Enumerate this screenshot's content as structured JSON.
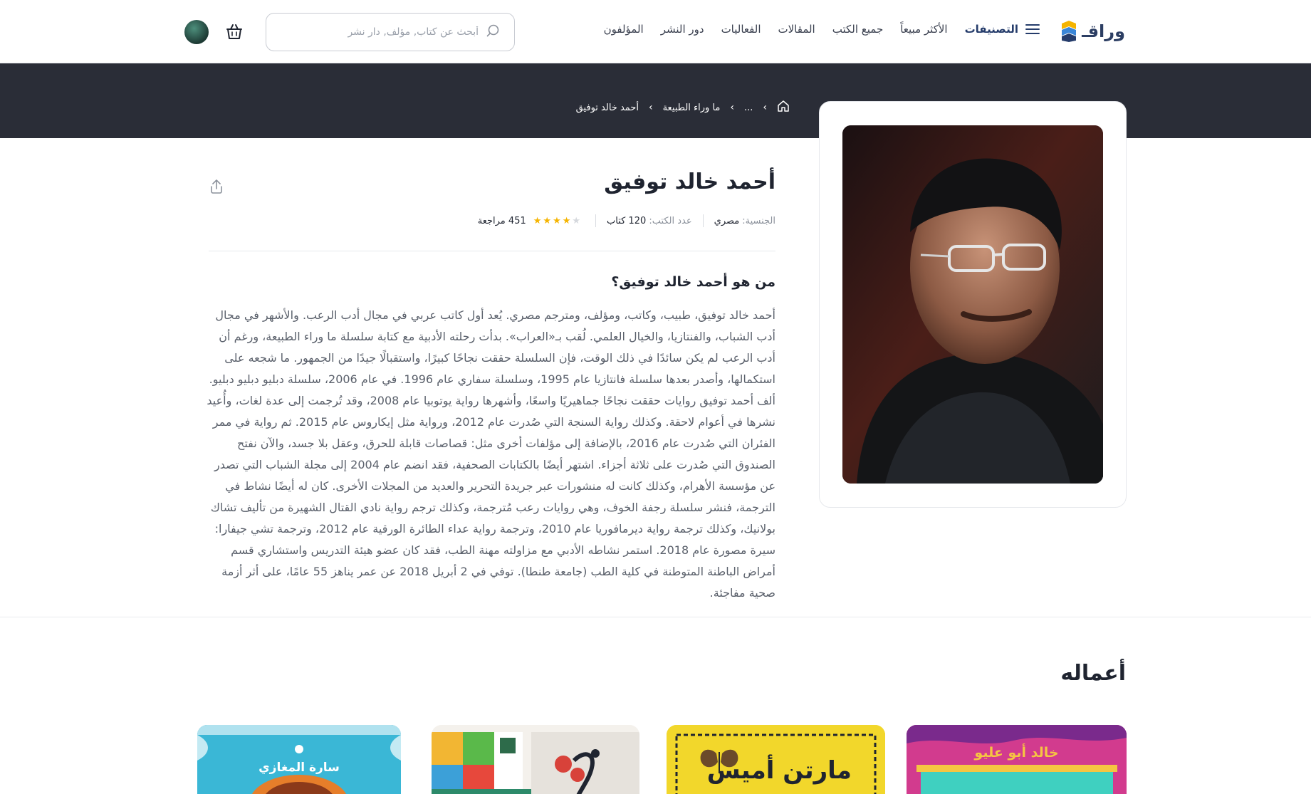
{
  "header": {
    "logo_text": "وراقـ",
    "nav": {
      "categories": "التصنيفات",
      "bestsellers": "الأكثر مبيعاً",
      "all_books": "جميع الكتب",
      "articles": "المقالات",
      "events": "الفعاليات",
      "publishers": "دور النشر",
      "authors": "المؤلفون"
    },
    "search_placeholder": "أبحث عن كتاب, مؤلف, دار نشر"
  },
  "breadcrumb": {
    "ellipsis": "...",
    "category": "ما وراء الطبيعة",
    "current": "أحمد خالد توفيق"
  },
  "author": {
    "name": "أحمد خالد توفيق",
    "nationality_label": "الجنسية:",
    "nationality": "مصري",
    "books_label": "عدد الكتب:",
    "books_count": "120 كتاب",
    "rating": 4,
    "rating_max": 5,
    "reviews": "451 مراجعة",
    "about_title": "من هو أحمد خالد توفيق؟",
    "about_text": "أحمد خالد توفيق، طبيب، وكاتب، ومؤلف، ومترجم مصري. يُعد أول كاتب عربي في مجال أدب الرعب. والأشهر في مجال أدب الشباب، والفنتازيا، والخيال العلمي. لُقب بـ«العراب». بدأت رحلته الأدبية مع كتابة سلسلة ما وراء الطبيعة، ورغم أن أدب الرعب لم يكن سائدًا في ذلك الوقت، فإن السلسلة حققت نجاحًا كبيرًا، واستقبالًا جيدًا من الجمهور. ما شجعه على استكمالها، وأصدر بعدها سلسلة فانتازيا عام 1995، وسلسلة سفاري عام 1996. في عام 2006، سلسلة دبليو دبليو دبليو. ألف أحمد توفيق روايات حققت نجاحًا جماهيريًا واسعًا، وأشهرها رواية يوتوبيا عام 2008، وقد تُرجمت إلى عدة لغات، وأُعيد نشرها في أعوام لاحقة. وكذلك رواية السنجة التي صُدرت عام 2012، ورواية مثل إيكاروس عام 2015. ثم رواية في ممر الفئران التي صُدرت عام 2016، بالإضافة إلى مؤلفات أخرى مثل: قصاصات قابلة للحرق، وعقل بلا جسد، والآن نفتح الصندوق التي صُدرت على ثلاثة أجزاء. اشتهر أيضًا بالكتابات الصحفية، فقد انضم عام 2004 إلى مجلة الشباب التي تصدر عن مؤسسة الأهرام، وكذلك كانت له منشورات عبر جريدة التحرير والعديد من المجلات الأخرى. كان له أيضًا نشاط في الترجمة، فنشر سلسلة رجفة الخوف، وهي روايات رعب مُترجمة، وكذلك ترجم رواية نادي القتال الشهيرة من تأليف تشاك بولانيك، وكذلك ترجمة رواية ديرمافوريا عام 2010، وترجمة رواية عداء الطائرة الورقية عام 2012، وترجمة تشي جيفارا: سيرة مصورة عام 2018. استمر نشاطه الأدبي مع مزاولته مهنة الطب، فقد كان عضو هيئة التدريس واستشاري قسم أمراض الباطنة المتوطنة في كلية الطب (جامعة طنطا). توفي في 2 أبريل 2018 عن عمر يناهز 55 عامًا، على أثر أزمة صحية مفاجئة."
  },
  "works": {
    "title": "أعماله",
    "books": [
      {
        "cover_text": "خالد أبو عليو",
        "color": "#d23b8e"
      },
      {
        "cover_text": "مارتن أميس",
        "color": "#f2d72b"
      },
      {
        "cover_text": "",
        "color": "#f4f1ec"
      },
      {
        "cover_text": "سارة المغازي",
        "color": "#3ab7d6"
      }
    ]
  },
  "colors": {
    "dark_band": "#2a2d37",
    "star_filled": "#f5b400",
    "star_empty": "#d5d8dd",
    "brand_blue": "#253c6b"
  },
  "icons": [
    "logo-icon",
    "menu-icon",
    "search-icon",
    "cart-icon",
    "avatar",
    "home-icon",
    "chevron-left-icon",
    "share-icon",
    "star-icon"
  ]
}
